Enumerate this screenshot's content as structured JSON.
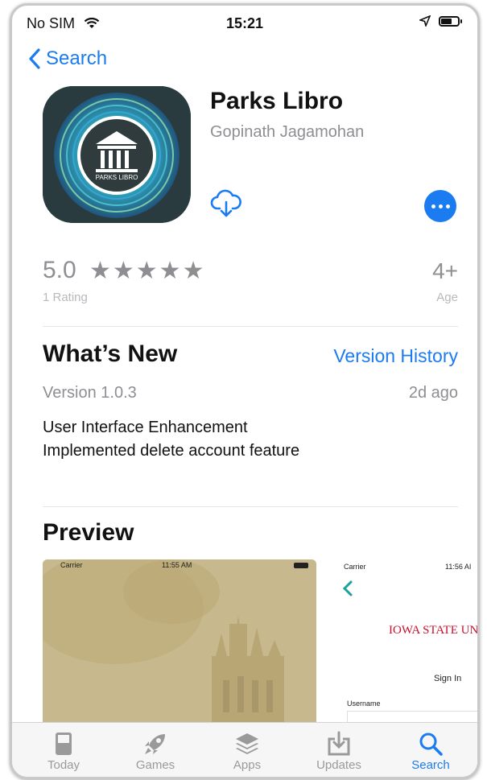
{
  "status_bar": {
    "carrier": "No SIM",
    "time": "15:21"
  },
  "nav": {
    "back_label": "Search"
  },
  "app": {
    "name": "Parks Libro",
    "developer": "Gopinath Jagamohan",
    "icon_text": "PARKS LIBRO"
  },
  "ratings": {
    "score": "5.0",
    "stars": "★★★★★",
    "count": "1 Rating",
    "age": "4+",
    "age_label": "Age"
  },
  "whats_new": {
    "title": "What’s New",
    "history_link": "Version History",
    "version": "Version 1.0.3",
    "date": "2d ago",
    "notes": [
      "User Interface Enhancement",
      "Implemented delete account feature"
    ]
  },
  "preview": {
    "title": "Preview",
    "shot1": {
      "carrier": "Carrier",
      "time": "11:55 AM"
    },
    "shot2": {
      "carrier": "Carrier",
      "time": "11:56 AI",
      "brand": "IOWA STATE UN",
      "signin": "Sign In",
      "username": "Username"
    }
  },
  "tabs": [
    {
      "label": "Today",
      "icon": "today-icon"
    },
    {
      "label": "Games",
      "icon": "rocket-icon"
    },
    {
      "label": "Apps",
      "icon": "stack-icon"
    },
    {
      "label": "Updates",
      "icon": "download-icon"
    },
    {
      "label": "Search",
      "icon": "search-icon",
      "active": true
    }
  ],
  "colors": {
    "accent": "#1a7cf0",
    "muted": "#8e8e93"
  }
}
